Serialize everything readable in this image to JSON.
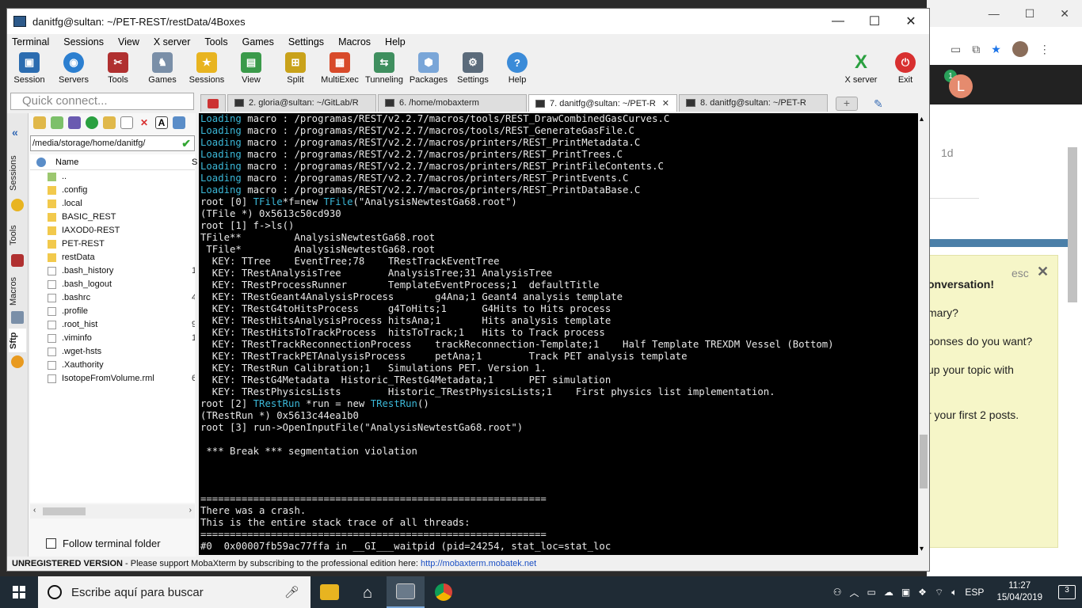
{
  "window": {
    "title": "danitfg@sultan: ~/PET-REST/restData/4Boxes",
    "minimize": "—",
    "maximize": "☐",
    "close": "✕"
  },
  "menu": [
    "Terminal",
    "Sessions",
    "View",
    "X server",
    "Tools",
    "Games",
    "Settings",
    "Macros",
    "Help"
  ],
  "toolbar": {
    "items": [
      {
        "label": "Session",
        "icon": "session-icon",
        "color": "#2b6cb0"
      },
      {
        "label": "Servers",
        "icon": "servers-icon",
        "color": "#2c7fd0"
      },
      {
        "label": "Tools",
        "icon": "tools-icon",
        "color": "#b03030"
      },
      {
        "label": "Games",
        "icon": "games-icon",
        "color": "#7a8fa8"
      },
      {
        "label": "Sessions",
        "icon": "star-icon",
        "color": "#e8b420"
      },
      {
        "label": "View",
        "icon": "view-icon",
        "color": "#3a9a4a"
      },
      {
        "label": "Split",
        "icon": "split-icon",
        "color": "#c9a21a"
      },
      {
        "label": "MultiExec",
        "icon": "multiexec-icon",
        "color": "#d84a2a"
      },
      {
        "label": "Tunneling",
        "icon": "tunneling-icon",
        "color": "#3f8f5f"
      },
      {
        "label": "Packages",
        "icon": "packages-icon",
        "color": "#7aa6d8"
      },
      {
        "label": "Settings",
        "icon": "settings-icon",
        "color": "#5b6b7b"
      },
      {
        "label": "Help",
        "icon": "help-icon",
        "color": "#3b8bd8"
      }
    ],
    "xserver": "X server",
    "exit": "Exit"
  },
  "quick_connect_placeholder": "Quick connect...",
  "tabs": [
    {
      "label": "2. gloria@sultan: ~/GitLab/R",
      "active": false
    },
    {
      "label": "6. /home/mobaxterm",
      "active": false
    },
    {
      "label": "7. danitfg@sultan: ~/PET-R",
      "active": true
    },
    {
      "label": "8. danitfg@sultan: ~/PET-R",
      "active": false
    }
  ],
  "sidebar_tabs": [
    "Sessions",
    "Tools",
    "Macros",
    "Sftp"
  ],
  "sftp": {
    "path": "/media/storage/home/danitfg/",
    "column_name": "Name",
    "column_size": "S",
    "files": [
      {
        "name": "..",
        "type": "up",
        "size": ""
      },
      {
        "name": ".config",
        "type": "dir",
        "size": ""
      },
      {
        "name": ".local",
        "type": "dir",
        "size": ""
      },
      {
        "name": "BASIC_REST",
        "type": "dir",
        "size": ""
      },
      {
        "name": "IAXOD0-REST",
        "type": "dir",
        "size": ""
      },
      {
        "name": "PET-REST",
        "type": "dir",
        "size": ""
      },
      {
        "name": "restData",
        "type": "dir",
        "size": ""
      },
      {
        "name": ".bash_history",
        "type": "file",
        "size": "1"
      },
      {
        "name": ".bash_logout",
        "type": "file",
        "size": ""
      },
      {
        "name": ".bashrc",
        "type": "file",
        "size": "4"
      },
      {
        "name": ".profile",
        "type": "file",
        "size": ""
      },
      {
        "name": ".root_hist",
        "type": "file",
        "size": "9"
      },
      {
        "name": ".viminfo",
        "type": "file",
        "size": "1"
      },
      {
        "name": ".wget-hsts",
        "type": "file",
        "size": ""
      },
      {
        "name": ".Xauthority",
        "type": "file",
        "size": ""
      },
      {
        "name": "IsotopeFromVolume.rml",
        "type": "file",
        "size": "6"
      }
    ],
    "follow_label": "Follow terminal folder"
  },
  "terminal": {
    "lines": [
      {
        "pre": "",
        "cy": "Loading",
        "post": " macro : /programas/REST/v2.2.7/macros/tools/REST_DrawCombinedGasCurves.C"
      },
      {
        "pre": "",
        "cy": "Loading",
        "post": " macro : /programas/REST/v2.2.7/macros/tools/REST_GenerateGasFile.C"
      },
      {
        "pre": "",
        "cy": "Loading",
        "post": " macro : /programas/REST/v2.2.7/macros/printers/REST_PrintMetadata.C"
      },
      {
        "pre": "",
        "cy": "Loading",
        "post": " macro : /programas/REST/v2.2.7/macros/printers/REST_PrintTrees.C"
      },
      {
        "pre": "",
        "cy": "Loading",
        "post": " macro : /programas/REST/v2.2.7/macros/printers/REST_PrintFileContents.C"
      },
      {
        "pre": "",
        "cy": "Loading",
        "post": " macro : /programas/REST/v2.2.7/macros/printers/REST_PrintEvents.C"
      },
      {
        "pre": "",
        "cy": "Loading",
        "post": " macro : /programas/REST/v2.2.7/macros/printers/REST_PrintDataBase.C"
      },
      {
        "pre": "root [0] ",
        "cy": "TFile",
        "post": "*f=new ",
        "cy2": "TFile",
        "post2": "(\"AnalysisNewtestGa68.root\")"
      },
      {
        "pre": "(TFile *) 0x5613c50cd930",
        "cy": "",
        "post": ""
      },
      {
        "pre": "root [1] f->ls()",
        "cy": "",
        "post": ""
      },
      {
        "pre": "TFile**         AnalysisNewtestGa68.root",
        "cy": "",
        "post": ""
      },
      {
        "pre": " TFile*         AnalysisNewtestGa68.root",
        "cy": "",
        "post": ""
      },
      {
        "pre": "  KEY: TTree    EventTree;78    TRestTrackEventTree",
        "cy": "",
        "post": ""
      },
      {
        "pre": "  KEY: TRestAnalysisTree        AnalysisTree;31 AnalysisTree",
        "cy": "",
        "post": ""
      },
      {
        "pre": "  KEY: TRestProcessRunner       TemplateEventProcess;1  defaultTitle",
        "cy": "",
        "post": ""
      },
      {
        "pre": "  KEY: TRestGeant4AnalysisProcess       g4Ana;1 Geant4 analysis template",
        "cy": "",
        "post": ""
      },
      {
        "pre": "  KEY: TRestG4toHitsProcess     g4ToHits;1      G4Hits to Hits process",
        "cy": "",
        "post": ""
      },
      {
        "pre": "  KEY: TRestHitsAnalysisProcess hitsAna;1       Hits analysis template",
        "cy": "",
        "post": ""
      },
      {
        "pre": "  KEY: TRestHitsToTrackProcess  hitsToTrack;1   Hits to Track process",
        "cy": "",
        "post": ""
      },
      {
        "pre": "  KEY: TRestTrackReconnectionProcess    trackReconnection-Template;1    Half Template TREXDM Vessel (Bottom)",
        "cy": "",
        "post": ""
      },
      {
        "pre": "  KEY: TRestTrackPETAnalysisProcess     petAna;1        Track PET analysis template",
        "cy": "",
        "post": ""
      },
      {
        "pre": "  KEY: TRestRun Calibration;1   Simulations PET. Version 1.",
        "cy": "",
        "post": ""
      },
      {
        "pre": "  KEY: TRestG4Metadata  Historic_TRestG4Metadata;1      PET simulation",
        "cy": "",
        "post": ""
      },
      {
        "pre": "  KEY: TRestPhysicsLists        Historic_TRestPhysicsLists;1    First physics list implementation.",
        "cy": "",
        "post": ""
      },
      {
        "pre": "root [2] ",
        "cy": "TRestRun",
        "post": " *run = new ",
        "cy2": "TRestRun",
        "post2": "()"
      },
      {
        "pre": "(TRestRun *) 0x5613c44ea1b0",
        "cy": "",
        "post": ""
      },
      {
        "pre": "root [3] run->OpenInputFile(\"AnalysisNewtestGa68.root\")",
        "cy": "",
        "post": ""
      },
      {
        "pre": "",
        "cy": "",
        "post": ""
      },
      {
        "pre": " *** Break *** segmentation violation",
        "cy": "",
        "post": ""
      },
      {
        "pre": "",
        "cy": "",
        "post": ""
      },
      {
        "pre": "",
        "cy": "",
        "post": ""
      },
      {
        "pre": "",
        "cy": "",
        "post": ""
      },
      {
        "pre": "===========================================================",
        "cy": "",
        "post": ""
      },
      {
        "pre": "There was a crash.",
        "cy": "",
        "post": ""
      },
      {
        "pre": "This is the entire stack trace of all threads:",
        "cy": "",
        "post": ""
      },
      {
        "pre": "===========================================================",
        "cy": "",
        "post": ""
      },
      {
        "pre": "#0  0x00007fb59ac77ffa in __GI___waitpid (pid=24254, stat_loc=stat_loc",
        "cy": "",
        "post": ""
      }
    ]
  },
  "status": {
    "bold": "UNREGISTERED VERSION",
    "text": "  -  Please support MobaXterm by subscribing to the professional edition here:  ",
    "link": "http://mobaxterm.mobatek.net"
  },
  "bg_window": {
    "badge": "1",
    "avatar_letter": "L",
    "time_ago": "1d",
    "esc": "esc",
    "popup_lines": [
      "onversation!",
      "mary?",
      "ponses do you want?",
      "up your topic with",
      "r your first 2 posts."
    ]
  },
  "taskbar": {
    "search_placeholder": "Escribe aquí para buscar",
    "lang": "ESP",
    "time": "11:27",
    "date": "15/04/2019",
    "notifications": "3"
  }
}
